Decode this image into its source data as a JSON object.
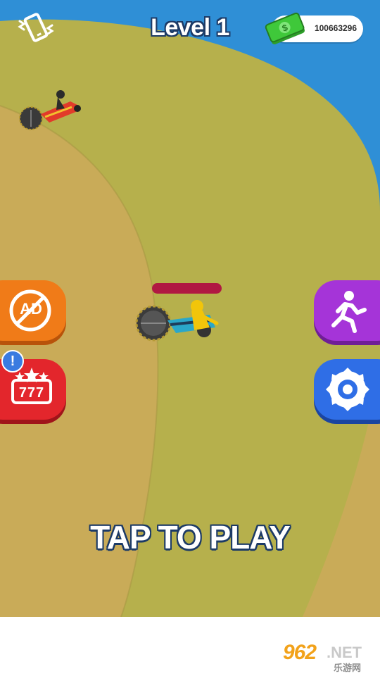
{
  "hud": {
    "level_label": "Level 1",
    "cash_amount": "100663296",
    "vibration_icon": "phone-vibrate-icon",
    "cash_icon": "dollar-bill-stack-icon"
  },
  "side_buttons": {
    "no_ads_text": "AD",
    "slots_text": "777",
    "notice_mark": "!",
    "runner_icon": "running-man-icon",
    "saw_icon": "saw-blade-icon"
  },
  "prompt": {
    "tap_to_play": "TAP TO PLAY"
  },
  "player": {
    "health_fraction": 1.0
  },
  "watermark": {
    "brand": "962",
    "domain": ".NET",
    "subtitle": "乐游网"
  },
  "colors": {
    "water": "#2f8fd6",
    "grass": "#b6b04c",
    "dirt": "#c9a955",
    "noads_orange": "#f07b18",
    "slots_red": "#e3262c",
    "runner_purple": "#a534d8",
    "saw_blue": "#2f6ee6",
    "health_red": "#b01842",
    "cash_green": "#3fc83a"
  }
}
